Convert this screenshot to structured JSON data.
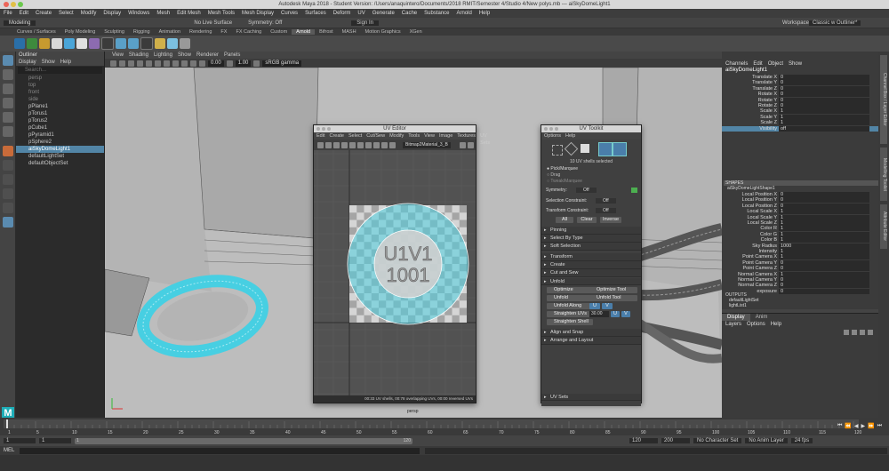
{
  "app": {
    "title": "Autodesk Maya 2018 - Student Version: /Users/anaquintero/Documents/2018 RMIT/Semester 4/Studio 4/New polys.mb    ---    aiSkyDomeLight1"
  },
  "menubar": [
    "File",
    "Edit",
    "Create",
    "Select",
    "Modify",
    "Display",
    "Windows",
    "Mesh",
    "Edit Mesh",
    "Mesh Tools",
    "Mesh Display",
    "Curves",
    "Surfaces",
    "Deform",
    "UV",
    "Generate",
    "Cache",
    "Substance",
    "Arnold",
    "Help"
  ],
  "statusline": {
    "mode": "Modeling",
    "live_surface": "No Live Surface",
    "symmetry": "Symmetry: Off",
    "sign_in": "Sign In",
    "workspace_label": "Workspace:",
    "workspace_value": "Classic w Outliner*"
  },
  "shelf_tabs": [
    "Curves / Surfaces",
    "Poly Modeling",
    "Sculpting",
    "Rigging",
    "Animation",
    "Rendering",
    "FX",
    "FX Caching",
    "Custom",
    "Arnold",
    "Bifrost",
    "MASH",
    "Motion Graphics",
    "XGen"
  ],
  "shelf_active_tab": "Arnold",
  "outliner": {
    "title": "Outliner",
    "menu": [
      "Display",
      "Show",
      "Help"
    ],
    "search_placeholder": "Search...",
    "items": [
      {
        "label": "persp",
        "state": "dim"
      },
      {
        "label": "top",
        "state": "dim"
      },
      {
        "label": "front",
        "state": "dim"
      },
      {
        "label": "side",
        "state": "dim"
      },
      {
        "label": "pPlane1",
        "state": "normal"
      },
      {
        "label": "pTorus1",
        "state": "normal"
      },
      {
        "label": "pTorus2",
        "state": "normal"
      },
      {
        "label": "pCube1",
        "state": "normal"
      },
      {
        "label": "pPyramid1",
        "state": "normal"
      },
      {
        "label": "pSphere2",
        "state": "normal"
      },
      {
        "label": "aiSkyDomeLight1",
        "state": "selected"
      },
      {
        "label": "defaultLightSet",
        "state": "normal"
      },
      {
        "label": "defaultObjectSet",
        "state": "normal"
      }
    ]
  },
  "viewport": {
    "menu": [
      "View",
      "Shading",
      "Lighting",
      "Show",
      "Renderer",
      "Panels"
    ],
    "field_a": "0.00",
    "field_b": "1.00",
    "color_space": "sRGB gamma",
    "camera_label": "persp"
  },
  "uv_editor": {
    "title": "UV Editor",
    "menu": [
      "Edit",
      "Create",
      "Select",
      "Cut/Sew",
      "Modify",
      "Tools",
      "View",
      "Image",
      "Textures",
      "UV Sets"
    ],
    "texture": "Bitmap2Material_3_B",
    "texture_text_line1": "U1V1",
    "texture_text_line2": "1001",
    "status": "00:33 UV shells, 00:78 overlapping UVs, 00:00 reversed UVs"
  },
  "uv_toolkit": {
    "title": "UV Toolkit",
    "menu": [
      "Options",
      "Help"
    ],
    "shells_selected": "10 UV shells selected",
    "pick_marquee": "Pick/Marquee",
    "drag": "Drag",
    "tweak_marquee": "Tweak/Marquee",
    "symmetry_label": "Symmetry:",
    "symmetry_value": "Off",
    "selection_constraint_label": "Selection Constraint:",
    "selection_constraint_value": "Off",
    "transform_constraint_label": "Transform Constraint:",
    "transform_constraint_value": "Off",
    "all": "All",
    "clear": "Clear",
    "inverse": "Inverse",
    "sections_top": [
      "Pinning",
      "Select By Type",
      "Soft Selection"
    ],
    "sections_mid": [
      "Transform",
      "Create",
      "Cut and Sew"
    ],
    "unfold_section": "Unfold",
    "optimize": "Optimize",
    "optimize_tool": "Optimize Tool",
    "unfold": "Unfold",
    "unfold_tool": "Unfold Tool",
    "unfold_along": "Unfold Along",
    "u": "U",
    "v": "V",
    "straighten_uvs": "Straighten UVs",
    "straighten_value": "30.00",
    "straighten_shell": "Straighten Shell",
    "sections_bottom": [
      "Align and Snap",
      "Arrange and Layout"
    ],
    "uv_sets": "UV Sets"
  },
  "channel_box": {
    "tabs": [
      "Channels",
      "Edit",
      "Object",
      "Show"
    ],
    "node": "aiSkyDomeLight1",
    "attrs": [
      {
        "label": "Translate X",
        "value": "0"
      },
      {
        "label": "Translate Y",
        "value": "0"
      },
      {
        "label": "Translate Z",
        "value": "0"
      },
      {
        "label": "Rotate X",
        "value": "0"
      },
      {
        "label": "Rotate Y",
        "value": "0"
      },
      {
        "label": "Rotate Z",
        "value": "0"
      },
      {
        "label": "Scale X",
        "value": "1"
      },
      {
        "label": "Scale Y",
        "value": "1"
      },
      {
        "label": "Scale Z",
        "value": "1"
      },
      {
        "label": "Visibility",
        "value": "off"
      }
    ],
    "shapes_header": "SHAPES",
    "shape_node": "aiSkyDomeLightShape1",
    "shape_attrs": [
      {
        "label": "Local Position X",
        "value": "0"
      },
      {
        "label": "Local Position Y",
        "value": "0"
      },
      {
        "label": "Local Position Z",
        "value": "0"
      },
      {
        "label": "Local Scale X",
        "value": "1"
      },
      {
        "label": "Local Scale Y",
        "value": "1"
      },
      {
        "label": "Local Scale Z",
        "value": "1"
      },
      {
        "label": "Color R",
        "value": "1"
      },
      {
        "label": "Color G",
        "value": "1"
      },
      {
        "label": "Color B",
        "value": "1"
      },
      {
        "label": "Sky Radius",
        "value": "1000"
      },
      {
        "label": "Intensity",
        "value": "1"
      },
      {
        "label": "Point Camera X",
        "value": "1"
      },
      {
        "label": "Point Camera Y",
        "value": "0"
      },
      {
        "label": "Point Camera Z",
        "value": "0"
      },
      {
        "label": "Normal Camera X",
        "value": "1"
      },
      {
        "label": "Normal Camera Y",
        "value": "0"
      },
      {
        "label": "Normal Camera Z",
        "value": "0"
      },
      {
        "label": "exposure",
        "value": "0"
      }
    ],
    "outputs_header": "OUTPUTS",
    "outputs": [
      "defaultLightSet",
      "lightList1"
    ]
  },
  "layer_editor": {
    "tabs": [
      "Display",
      "Anim"
    ],
    "menu": [
      "Layers",
      "Options",
      "Help"
    ]
  },
  "right_tabs": [
    "Channel Box / Layer Editor",
    "Modelling Toolkit",
    "Attribute Editor"
  ],
  "timeline": {
    "ticks": [
      "1",
      "5",
      "10",
      "15",
      "20",
      "25",
      "30",
      "35",
      "40",
      "45",
      "50",
      "55",
      "60",
      "65",
      "70",
      "75",
      "80",
      "85",
      "90",
      "95",
      "100",
      "105",
      "110",
      "115",
      "120"
    ],
    "current": "1"
  },
  "range": {
    "start": "1",
    "start2": "1",
    "range_start": "1",
    "range_end": "120",
    "end": "120",
    "end2": "200",
    "character_set": "No Character Set",
    "anim_layer": "No Anim Layer",
    "fps": "24 fps"
  },
  "cmdline": {
    "label": "MEL"
  },
  "colors": {
    "accent": "#5285a6",
    "uv_cyan": "#4fd0e0",
    "selected_blue": "#4a7eaa"
  }
}
